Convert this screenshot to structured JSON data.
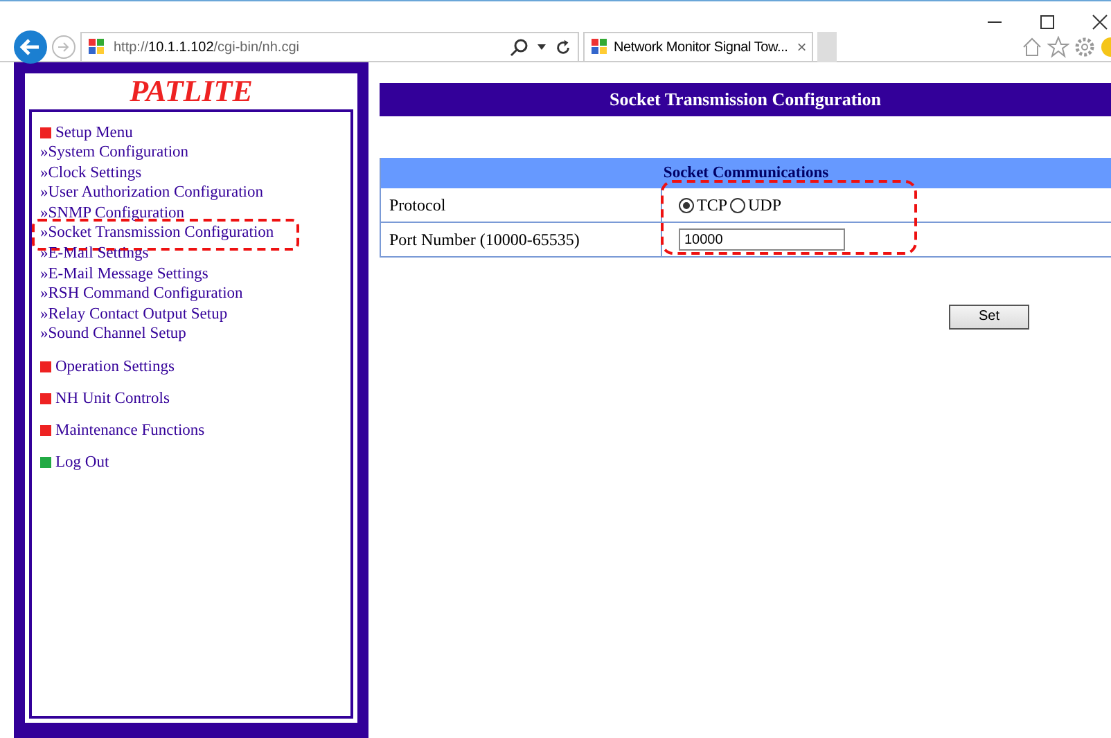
{
  "browser": {
    "url_prefix": "http://",
    "url_host": "10.1.1.102",
    "url_path": "/cgi-bin/nh.cgi",
    "tab_title": "Network Monitor Signal Tow...",
    "tab_close": "×"
  },
  "sidebar": {
    "logo": "PATLITE",
    "sections": [
      {
        "title": "Setup Menu",
        "color": "#ee2222",
        "items": [
          {
            "label": "»System Configuration",
            "highlighted": false
          },
          {
            "label": "»Clock Settings",
            "highlighted": false
          },
          {
            "label": "»User Authorization Configuration",
            "highlighted": false
          },
          {
            "label": "»SNMP Configuration",
            "highlighted": false
          },
          {
            "label": "»Socket Transmission Configuration",
            "highlighted": true
          },
          {
            "label": "»E-Mail Settings",
            "highlighted": false
          },
          {
            "label": "»E-Mail Message Settings",
            "highlighted": false
          },
          {
            "label": "»RSH Command Configuration",
            "highlighted": false
          },
          {
            "label": "»Relay Contact Output Setup",
            "highlighted": false
          },
          {
            "label": "»Sound Channel Setup",
            "highlighted": false
          }
        ]
      },
      {
        "title": "Operation Settings",
        "color": "#ee2222"
      },
      {
        "title": "NH Unit Controls",
        "color": "#ee2222"
      },
      {
        "title": "Maintenance Functions",
        "color": "#ee2222"
      },
      {
        "title": "Log Out",
        "color": "#22aa44"
      }
    ]
  },
  "page": {
    "title": "Socket Transmission Configuration",
    "table": {
      "heading": "Socket Communications",
      "values_highlighted": true,
      "protocol": {
        "label": "Protocol",
        "options": [
          {
            "label": "TCP",
            "selected": true
          },
          {
            "label": "UDP",
            "selected": false
          }
        ]
      },
      "port": {
        "label": "Port Number (10000-65535)",
        "value": "10000"
      }
    },
    "set_button": "Set"
  }
}
